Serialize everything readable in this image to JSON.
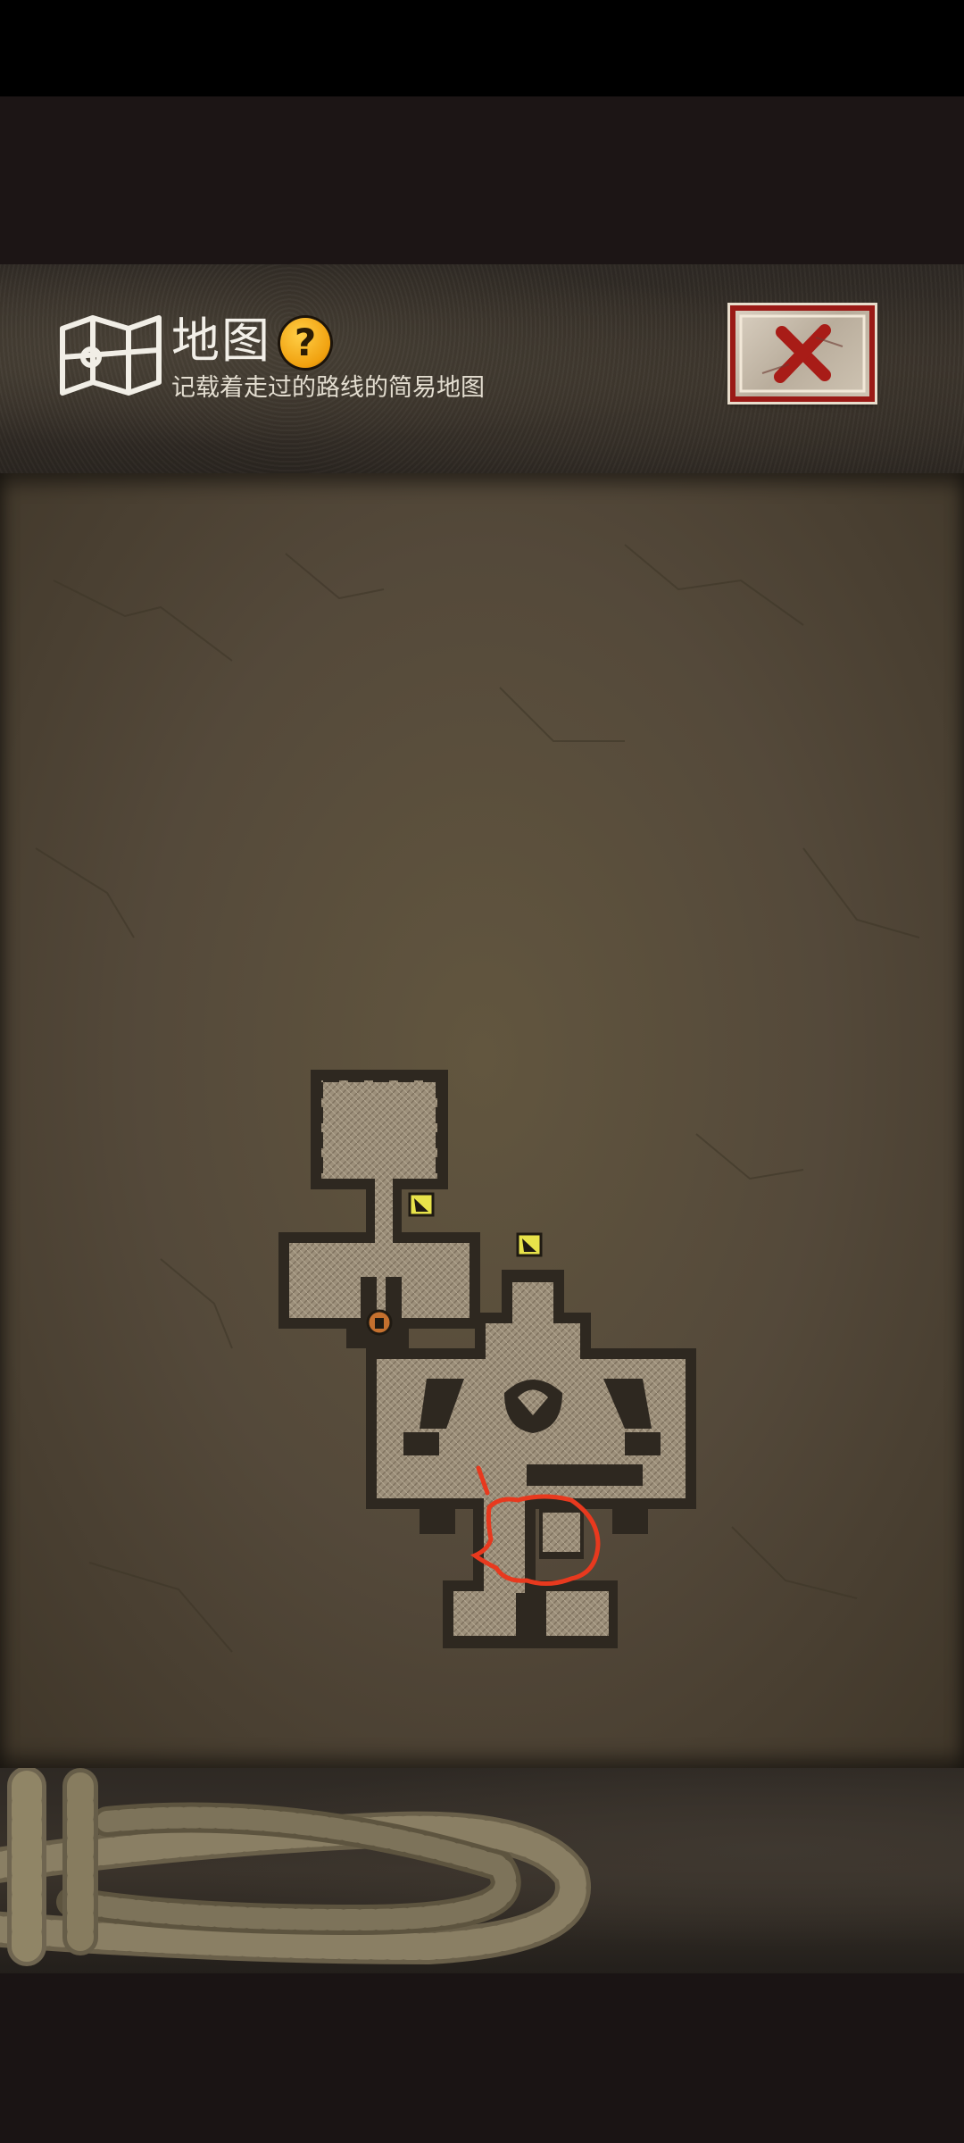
{
  "header": {
    "title": "地图",
    "subtitle": "记载着走过的路线的简易地图",
    "help_icon_text": "?"
  },
  "icons": {
    "map": "map-icon",
    "help": "question-icon",
    "close": "close-x-icon",
    "stairs": "stairs-icon",
    "door": "door-icon",
    "rope": "rope-decoration"
  },
  "colors": {
    "accent_red": "#9a1a16",
    "help_yellow": "#f0a00e",
    "annotation_red": "#e8391e"
  }
}
